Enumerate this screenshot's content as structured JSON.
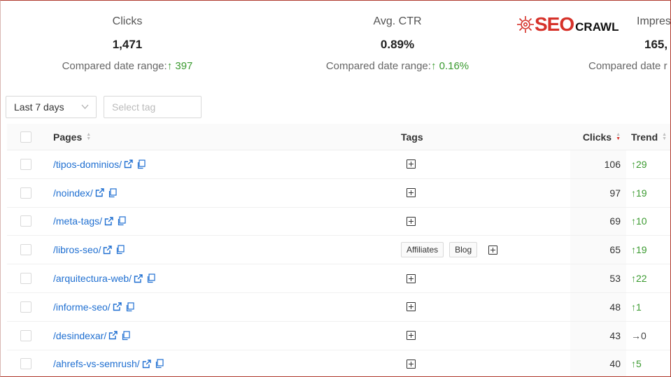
{
  "stats": {
    "clicks": {
      "title": "Clicks",
      "value": "1,471",
      "compare_label": "Compared date range:",
      "arrow": "↑",
      "delta": "397"
    },
    "ctr": {
      "title": "Avg. CTR",
      "value": "0.89%",
      "compare_label": "Compared date range:",
      "arrow": "↑",
      "delta": "0.16%"
    },
    "impressions": {
      "title": "Impres",
      "value": "165,",
      "compare_label": "Compared date r"
    }
  },
  "logo": {
    "part1": "SEO",
    "part2": "CRAWL"
  },
  "filters": {
    "range": "Last 7 days",
    "tag_placeholder": "Select tag"
  },
  "table": {
    "headers": {
      "pages": "Pages",
      "tags": "Tags",
      "clicks": "Clicks",
      "trend": "Trend"
    },
    "rows": [
      {
        "page": "/tipos-dominios/",
        "tags": [],
        "clicks": "106",
        "trend": "↑29",
        "trend_dir": "up"
      },
      {
        "page": "/noindex/",
        "tags": [],
        "clicks": "97",
        "trend": "↑19",
        "trend_dir": "up"
      },
      {
        "page": "/meta-tags/",
        "tags": [],
        "clicks": "69",
        "trend": "↑10",
        "trend_dir": "up"
      },
      {
        "page": "/libros-seo/",
        "tags": [
          "Affiliates",
          "Blog"
        ],
        "clicks": "65",
        "trend": "↑19",
        "trend_dir": "up"
      },
      {
        "page": "/arquitectura-web/",
        "tags": [],
        "clicks": "53",
        "trend": "↑22",
        "trend_dir": "up"
      },
      {
        "page": "/informe-seo/",
        "tags": [],
        "clicks": "48",
        "trend": "↑1",
        "trend_dir": "up"
      },
      {
        "page": "/desindexar/",
        "tags": [],
        "clicks": "43",
        "trend": "→0",
        "trend_dir": "flat"
      },
      {
        "page": "/ahrefs-vs-semrush/",
        "tags": [],
        "clicks": "40",
        "trend": "↑5",
        "trend_dir": "up"
      }
    ]
  },
  "colors": {
    "accent": "#d6322a",
    "link": "#1f6fd1",
    "positive": "#3a9a2f"
  },
  "icons": {
    "external": "external-link-icon",
    "copy": "copy-icon",
    "add_tag": "plus-square-icon",
    "sort": "sort-icon",
    "dropdown": "chevron-down-icon",
    "logo": "gear-icon"
  }
}
